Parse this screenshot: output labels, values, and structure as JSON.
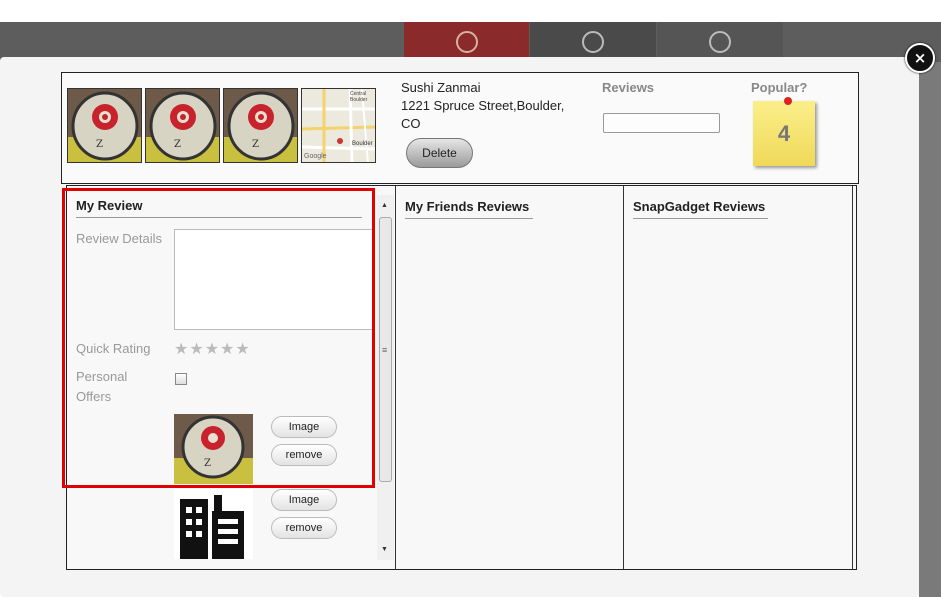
{
  "modal": {
    "close_glyph": "×"
  },
  "restaurant": {
    "name": "Sushi Zanmai",
    "address_line": "1221 Spruce Street,Boulder,",
    "state": "CO"
  },
  "map_labels": {
    "central": "Central",
    "boulder_top": "Boulder",
    "boulder": "Boulder",
    "google": "Google"
  },
  "header": {
    "delete_label": "Delete",
    "reviews_label": "Reviews",
    "reviews_value": "",
    "popular_label": "Popular?",
    "popular_count": "4"
  },
  "columns": {
    "my_review": "My Review",
    "friends": "My Friends Reviews",
    "snapgadget": "SnapGadget Reviews"
  },
  "form": {
    "review_details_label": "Review Details",
    "review_details_value": "",
    "quick_rating_label": "Quick Rating",
    "stars": "★★★★★",
    "rating_value": 0,
    "personal_offers_line1": "Personal",
    "personal_offers_line2": "Offers",
    "personal_offers_checked": false
  },
  "images": [
    {
      "icon": "zanmai-sign-photo",
      "image_label": "Image",
      "remove_label": "remove"
    },
    {
      "icon": "building-placeholder-icon",
      "image_label": "Image",
      "remove_label": "remove"
    }
  ],
  "scrollbar": {
    "up": "▲",
    "down": "▼",
    "grip": "≡"
  },
  "colors": {
    "highlight": "#e00000",
    "sticky_note": "#f6e46e",
    "pin": "#d22222"
  }
}
